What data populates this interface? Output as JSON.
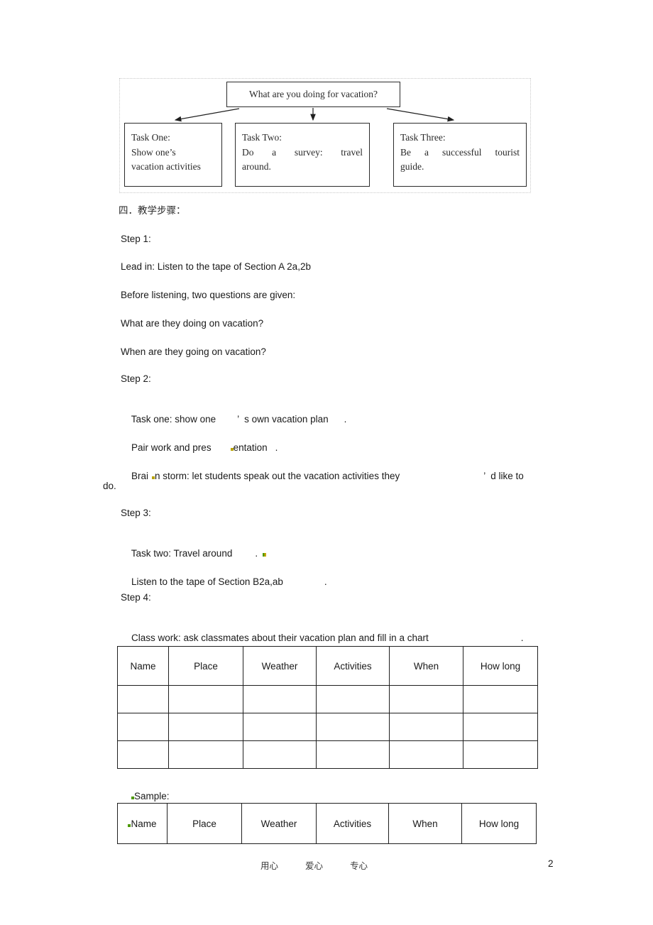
{
  "document": {
    "page_number": "2",
    "footer_terms": [
      "用心",
      "爱心",
      "专心"
    ]
  },
  "diagram": {
    "title_box": "What are you doing for vacation?",
    "tasks": [
      {
        "heading": "Task One:",
        "lines": [
          "Show one’s",
          "vacation activities"
        ]
      },
      {
        "heading": "Task Two:",
        "lines": [
          "Do  a  survey:  travel",
          "around."
        ]
      },
      {
        "heading": "Task Three:",
        "lines": [
          "Be  a  successful  tourist",
          "guide."
        ]
      }
    ]
  },
  "body": {
    "section_heading": "四．教学步骤：",
    "steps": [
      {
        "label": "Step 1:",
        "lines": [
          "Lead in: Listen to the tape of Section A 2a,2b",
          "Before listening, two questions are given:",
          "What are they doing on vacation?",
          "When are they going on vacation?"
        ]
      },
      {
        "label": "Step 2:",
        "lines": [
          "Task one: show one      ’  s own vacation plan        .",
          "Pair work and pres      entation   .",
          "Brai  n storm: let students speak out the vacation activities they                    ’  d like to",
          "do."
        ]
      },
      {
        "label": "Step 3:",
        "lines": [
          "Task two: Travel around        .",
          "Listen to the tape of Section B2a,ab            ."
        ]
      },
      {
        "label": "Step 4:",
        "lines": [
          "Class work: ask classmates about their vacation plan and fill in a chart"
        ]
      }
    ],
    "text_fragments": {
      "step1_label": "Step 1:",
      "step1_l1": "Lead in: Listen to the tape of Section A 2a,2b",
      "step1_l2": "Before listening, two questions are given:",
      "step1_l3": "What are they doing on vacation?",
      "step1_l4": "When are they going on vacation?",
      "step2_label": "Step 2:",
      "step2_a1": "Task one: show one",
      "step2_a2": "’",
      "step2_a3": "s own vacation plan",
      "step2_a4": ".",
      "step2_b1": "Pair work and pres",
      "step2_b2": "entation",
      "step2_b3": ".",
      "step2_c1": "Brai",
      "step2_c2": "n storm: let students speak out the vacation activities they",
      "step2_c3": "’",
      "step2_c4": "d like to",
      "step2_c5": "do.",
      "step3_label": "Step 3:",
      "step3_a1": "Task two: Travel around",
      "step3_a2": ".",
      "step3_b1": "Listen to the tape of Section B2a,ab",
      "step3_b2": ".",
      "step4_label": "Step 4:",
      "step4_a1": "Class work: ask classmates about their vacation plan and fill in a chart",
      "step4_a2": ".",
      "sample_label": "Sample:"
    }
  },
  "tables": {
    "survey_table": {
      "headers": [
        "Name",
        "Place",
        "Weather",
        "Activities",
        "When",
        "How long"
      ],
      "rows": [
        [
          "",
          "",
          "",
          "",
          "",
          ""
        ],
        [
          "",
          "",
          "",
          "",
          "",
          ""
        ],
        [
          "",
          "",
          "",
          "",
          "",
          ""
        ]
      ]
    },
    "sample_table": {
      "headers": [
        "Name",
        "Place",
        "Weather",
        "Activities",
        "When",
        "How long"
      ],
      "rows": []
    }
  },
  "colors": {
    "text": "#1a1a1a",
    "border": "#1f1f1f",
    "mark_olive": "#b8a300",
    "mark_green": "#4e9a06",
    "diagram_outer_border": "#c9c9c9"
  }
}
